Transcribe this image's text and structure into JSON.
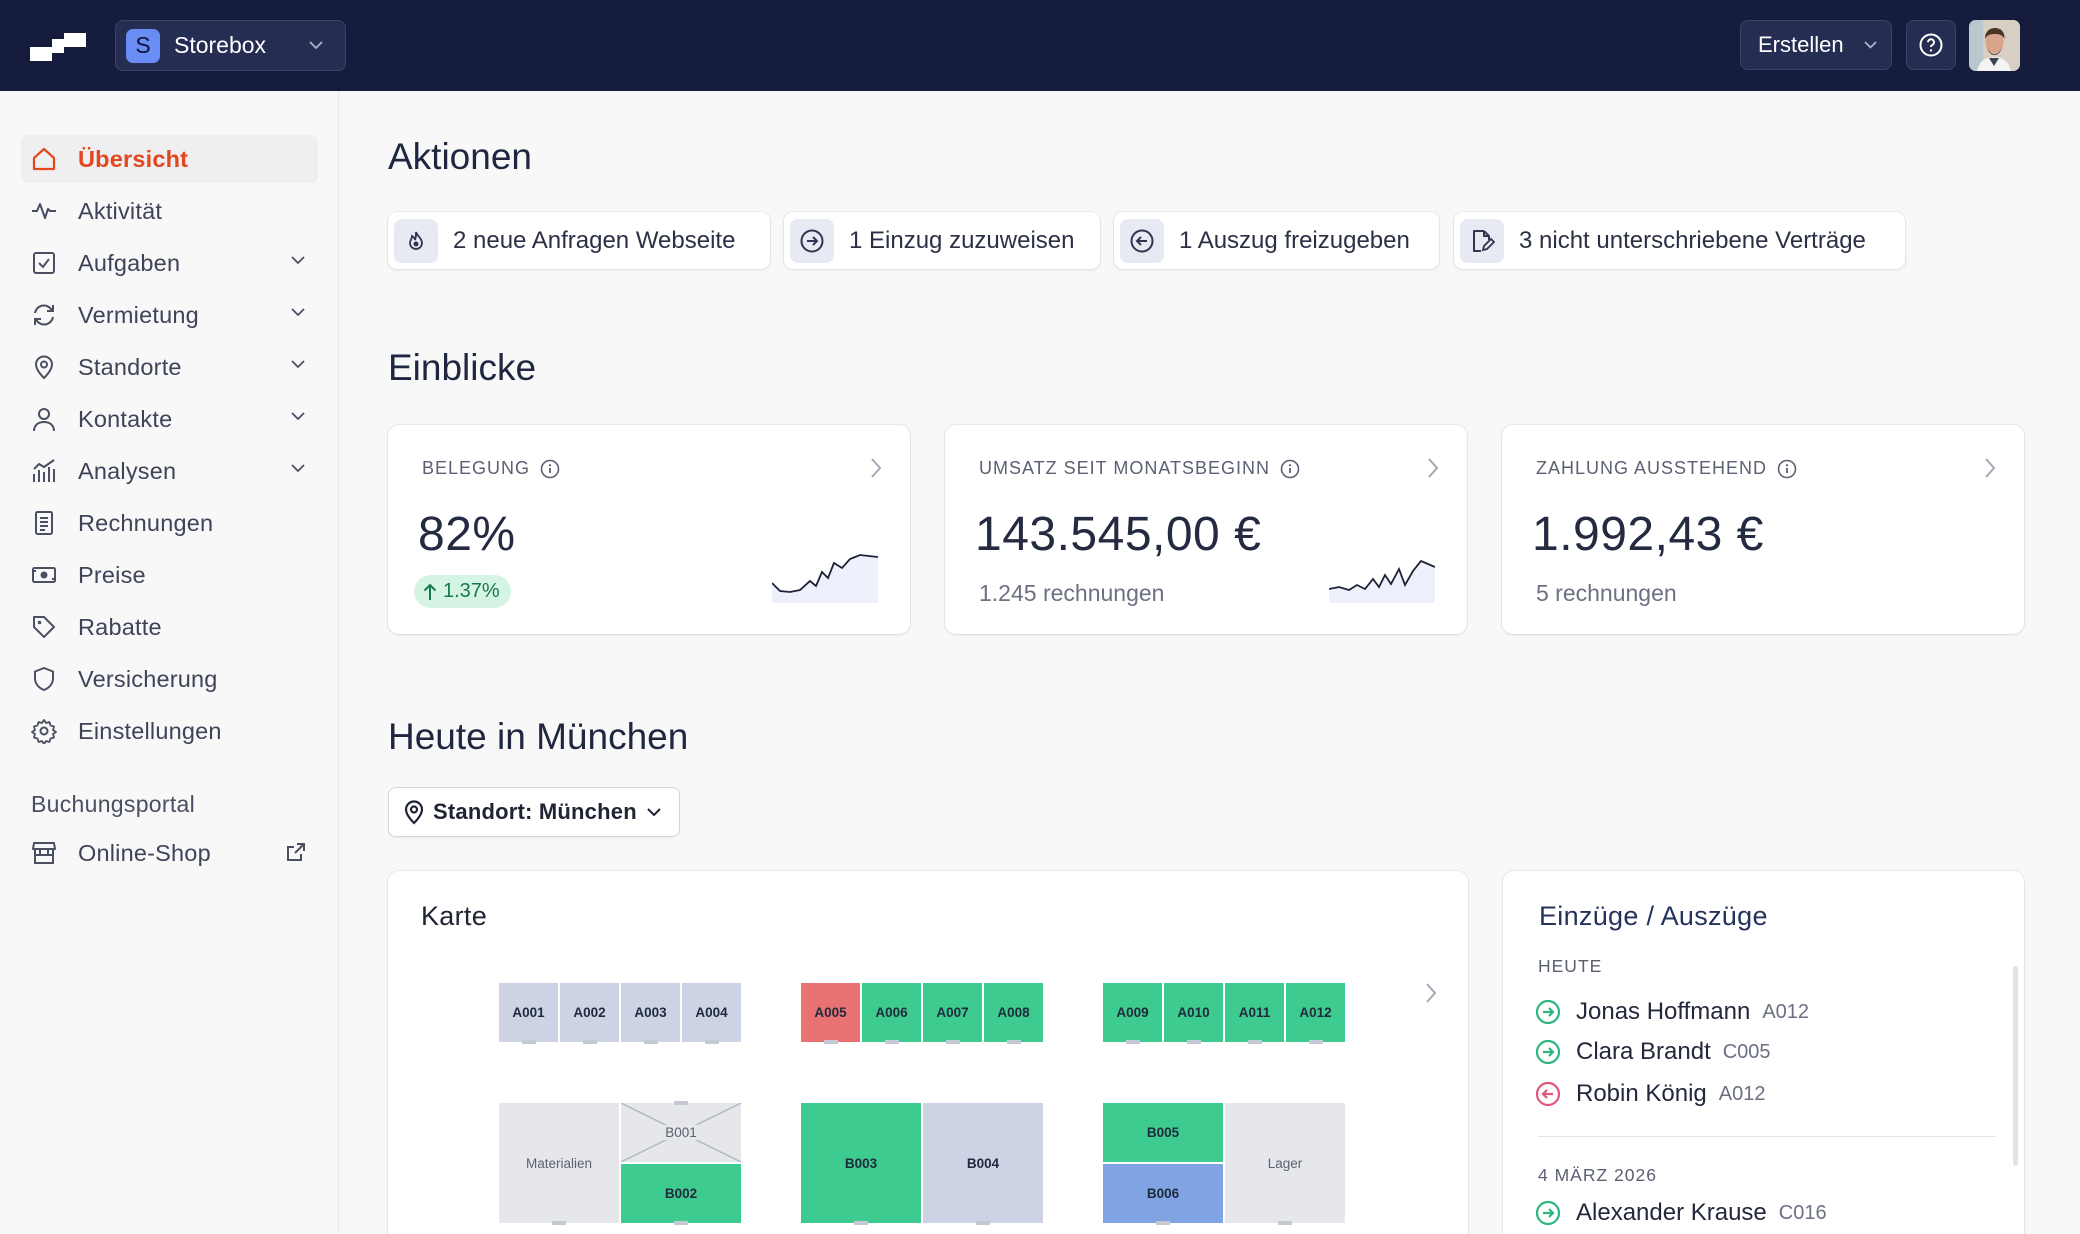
{
  "app": {
    "workspace": "Storebox",
    "workspace_initial": "S",
    "create_label": "Erstellen",
    "accent": "#e4461d",
    "topbar_bg": "#151c3d"
  },
  "sidebar": {
    "items": [
      {
        "label": "Übersicht",
        "icon": "home-icon",
        "active": true
      },
      {
        "label": "Aktivität",
        "icon": "activity-icon"
      },
      {
        "label": "Aufgaben",
        "icon": "checkbox-icon",
        "expandable": true
      },
      {
        "label": "Vermietung",
        "icon": "refresh-icon",
        "expandable": true
      },
      {
        "label": "Standorte",
        "icon": "map-pin-icon",
        "expandable": true
      },
      {
        "label": "Kontakte",
        "icon": "user-icon",
        "expandable": true
      },
      {
        "label": "Analysen",
        "icon": "chart-icon",
        "expandable": true
      },
      {
        "label": "Rechnungen",
        "icon": "invoice-icon"
      },
      {
        "label": "Preise",
        "icon": "banknote-icon"
      },
      {
        "label": "Rabatte",
        "icon": "tag-icon"
      },
      {
        "label": "Versicherung",
        "icon": "shield-icon"
      },
      {
        "label": "Einstellungen",
        "icon": "gear-icon"
      }
    ],
    "section_title": "Buchungsportal",
    "portal_item": {
      "label": "Online-Shop",
      "icon": "store-icon"
    }
  },
  "actions": {
    "title": "Aktionen",
    "chips": [
      {
        "label": "2 neue Anfragen Webseite",
        "icon": "flame-icon"
      },
      {
        "label": "1 Einzug zuzuweisen",
        "icon": "arrow-right-circle-icon"
      },
      {
        "label": "1 Auszug freizugeben",
        "icon": "arrow-left-circle-icon"
      },
      {
        "label": "3 nicht unterschriebene Verträge",
        "icon": "document-sign-icon"
      }
    ]
  },
  "insights": {
    "title": "Einblicke",
    "cards": [
      {
        "title": "BELEGUNG",
        "value": "82%",
        "badge": "1.37%"
      },
      {
        "title": "UMSATZ SEIT MONATSBEGINN",
        "value": "143.545,00 €",
        "sub": "1.245 rechnungen"
      },
      {
        "title": "ZAHLUNG AUSSTEHEND",
        "value": "1.992,43 €",
        "sub": "5 rechnungen"
      }
    ]
  },
  "today": {
    "title": "Heute in München",
    "location_select": "Standort: München",
    "map": {
      "title": "Karte",
      "units": {
        "A001": "A001",
        "A002": "A002",
        "A003": "A003",
        "A004": "A004",
        "A005": "A005",
        "A006": "A006",
        "A007": "A007",
        "A008": "A008",
        "A009": "A009",
        "A010": "A010",
        "A011": "A011",
        "A012": "A012",
        "B001": "B001",
        "B002": "B002",
        "B003": "B003",
        "B004": "B004",
        "B005": "B005",
        "B006": "B006",
        "materials": "Materialien",
        "storage": "Lager"
      },
      "status_colors": {
        "free": "#cdd3e5",
        "occupied": "#3ecb90",
        "overdue": "#e97373",
        "reserved": "#7fa3e3"
      }
    },
    "moves": {
      "title": "Einzüge / Auszüge",
      "groups": [
        {
          "day": "HEUTE",
          "entries": [
            {
              "name": "Jonas Hoffmann",
              "unit": "A012",
              "type": "in"
            },
            {
              "name": "Clara Brandt",
              "unit": "C005",
              "type": "in"
            },
            {
              "name": "Robin König",
              "unit": "A012",
              "type": "out"
            }
          ]
        },
        {
          "day": "4 MÄRZ 2026",
          "entries": [
            {
              "name": "Alexander Krause",
              "unit": "C016",
              "type": "in"
            }
          ]
        }
      ]
    }
  }
}
